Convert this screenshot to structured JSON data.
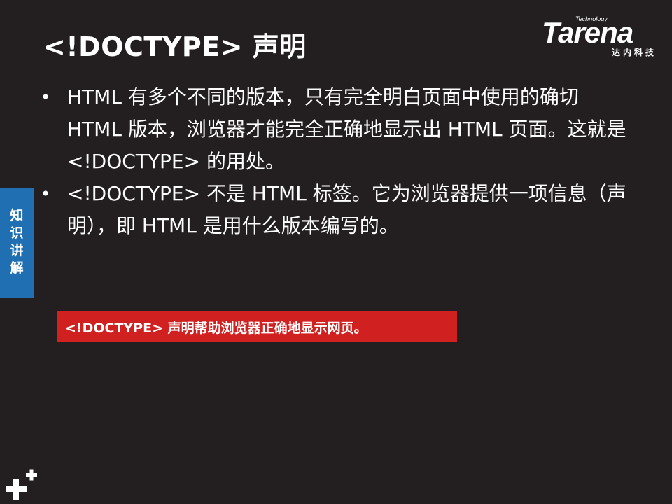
{
  "title": "<!DOCTYPE> 声明",
  "logo": {
    "tech_label": "Technology",
    "brand": "Tarena",
    "subtitle": "达内科技",
    "icon": "tarena-logo-icon"
  },
  "side_tab": {
    "label": "知识讲解"
  },
  "bullets": [
    {
      "marker": "•",
      "text": "HTML 有多个不同的版本，只有完全明白页面中使用的确切 HTML 版本，浏览器才能完全正确地显示出 HTML 页面。这就是 <!DOCTYPE> 的用处。"
    },
    {
      "marker": "•",
      "text": "<!DOCTYPE> 不是 HTML 标签。它为浏览器提供一项信息（声明），即 HTML 是用什么版本编写的。"
    }
  ],
  "callout": {
    "text": "<!DOCTYPE> 声明帮助浏览器正确地显示网页。",
    "color": "#d0201f"
  },
  "footer": {
    "icon": "plus-plus-icon"
  },
  "colors": {
    "background": "#231f20",
    "tab": "#1f6fb2",
    "callout": "#d0201f",
    "text": "#ffffff"
  }
}
